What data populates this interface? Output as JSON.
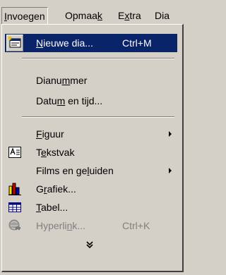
{
  "menubar": {
    "items": [
      {
        "label": "Invoegen",
        "mnemonic_index": 0
      },
      {
        "label": "Opmaak",
        "mnemonic_index": 5
      },
      {
        "label": "Extra",
        "mnemonic_index": 1
      },
      {
        "label": "Dia",
        "mnemonic_index": -1
      }
    ],
    "open_menu": "Invoegen"
  },
  "menu": {
    "items": [
      {
        "label": "Nieuwe dia...",
        "mnemonic_index": 0,
        "shortcut": "Ctrl+M",
        "icon": "new-slide-icon",
        "highlighted": true,
        "enabled": true
      },
      {
        "label": "Dianummer",
        "mnemonic_index": 5,
        "shortcut": "",
        "icon": "",
        "enabled": true
      },
      {
        "label": "Datum en tijd...",
        "mnemonic_index": 4,
        "shortcut": "",
        "icon": "",
        "enabled": true
      },
      {
        "label": "Figuur",
        "mnemonic_index": 0,
        "shortcut": "",
        "icon": "",
        "submenu": true,
        "enabled": true
      },
      {
        "label": "Tekstvak",
        "mnemonic_index": 1,
        "shortcut": "",
        "icon": "text-box-icon",
        "enabled": true
      },
      {
        "label": "Films en geluiden",
        "mnemonic_index": 11,
        "shortcut": "",
        "icon": "",
        "submenu": true,
        "enabled": true
      },
      {
        "label": "Grafiek...",
        "mnemonic_index": 1,
        "shortcut": "",
        "icon": "chart-icon",
        "enabled": true
      },
      {
        "label": "Tabel...",
        "mnemonic_index": 0,
        "shortcut": "",
        "icon": "table-icon",
        "enabled": true
      },
      {
        "label": "Hyperlink...",
        "mnemonic_index": 7,
        "shortcut": "Ctrl+K",
        "icon": "hyperlink-icon",
        "enabled": false
      }
    ],
    "expand_glyph": "expand-menu-icon"
  },
  "colors": {
    "menu_bg": "#d4d0c8",
    "highlight": "#0a246a",
    "disabled_text": "#808080"
  }
}
